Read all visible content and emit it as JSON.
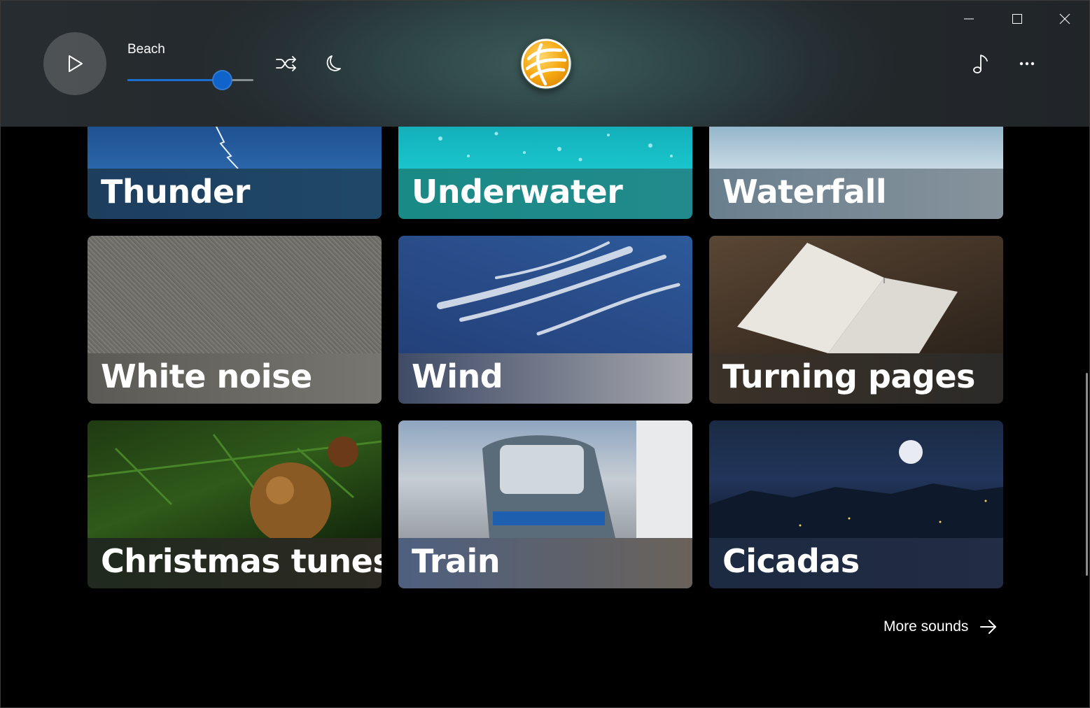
{
  "window": {
    "controls": [
      "minimize",
      "maximize",
      "close"
    ]
  },
  "header": {
    "track_name": "Beach",
    "volume_percent": 75,
    "icons": {
      "play": "play-icon",
      "shuffle": "shuffle-icon",
      "sleep": "moon-icon",
      "music": "music-note-icon",
      "more": "more-icon"
    },
    "accent": "#0f63c9"
  },
  "tiles": [
    {
      "label": "Thunder",
      "band_from": "#1e3e5e",
      "band_to": "#1f4868"
    },
    {
      "label": "Underwater",
      "band_from": "#1a8a86",
      "band_to": "#228a8c"
    },
    {
      "label": "Waterfall",
      "band_from": "#6a7f8e",
      "band_to": "#86939c"
    },
    {
      "label": "White noise",
      "band_from": "#5b5a55",
      "band_to": "#777670"
    },
    {
      "label": "Wind",
      "band_from": "#3f4b66",
      "band_to": "#a6a7ad"
    },
    {
      "label": "Turning pages",
      "band_from": "#3b3228",
      "band_to": "#2b2a28"
    },
    {
      "label": "Christmas tunes",
      "band_from": "#202a1e",
      "band_to": "#2c2a22"
    },
    {
      "label": "Train",
      "band_from": "#4e6080",
      "band_to": "#6a625a"
    },
    {
      "label": "Cicadas",
      "band_from": "#1c2a42",
      "band_to": "#222c44"
    }
  ],
  "footer": {
    "more_label": "More sounds",
    "more_icon": "arrow-right-icon"
  }
}
